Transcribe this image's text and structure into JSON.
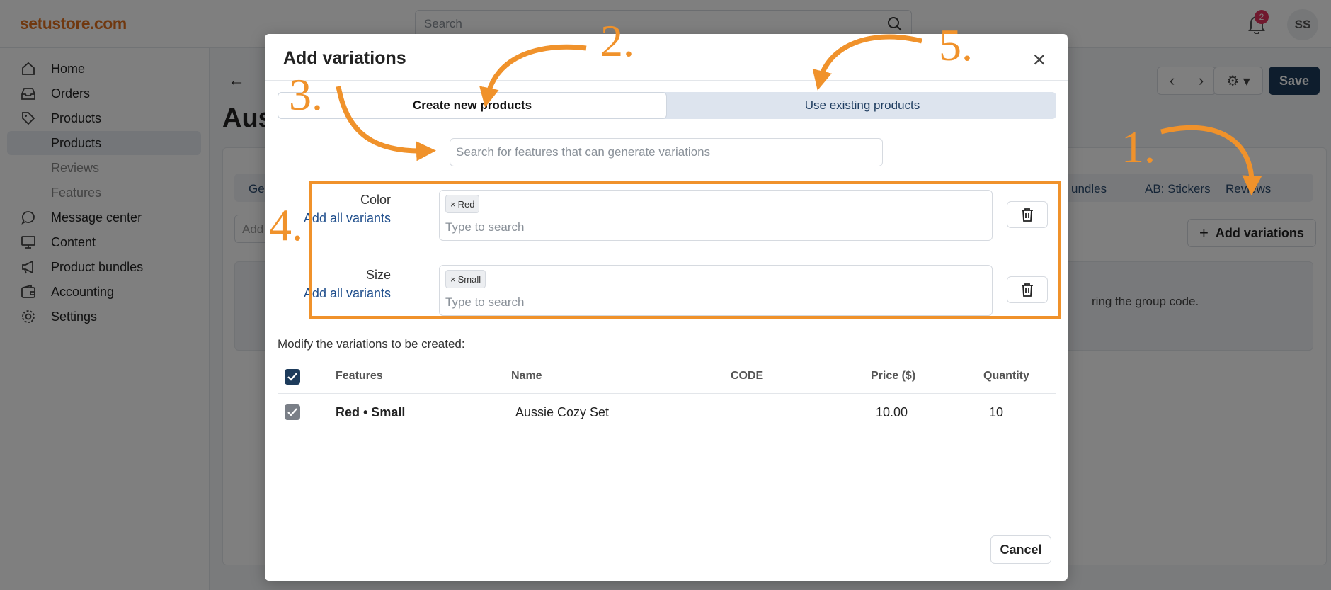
{
  "app": {
    "logo": "setustore.com",
    "search_placeholder": "Search",
    "notification_count": "2",
    "user_initials": "SS"
  },
  "sidebar": {
    "items": [
      {
        "label": "Home",
        "icon": "home-icon"
      },
      {
        "label": "Orders",
        "icon": "inbox-icon"
      },
      {
        "label": "Products",
        "icon": "tag-icon"
      },
      {
        "label": "Products",
        "icon": "",
        "sub": true,
        "active": true
      },
      {
        "label": "Reviews",
        "icon": "",
        "sub": true
      },
      {
        "label": "Features",
        "icon": "",
        "sub": true
      },
      {
        "label": "Message center",
        "icon": "chat-icon"
      },
      {
        "label": "Content",
        "icon": "monitor-icon"
      },
      {
        "label": "Product bundles",
        "icon": "megaphone-icon"
      },
      {
        "label": "Accounting",
        "icon": "wallet-icon"
      },
      {
        "label": "Settings",
        "icon": "gear-icon"
      }
    ]
  },
  "page": {
    "title": "Aus",
    "save_label": "Save",
    "tab_first": "Ge",
    "tab_bundles": "undles",
    "tab_stickers": "AB: Stickers",
    "tab_reviews": "Reviews",
    "add_input_placeholder": "Add",
    "add_variations_label": "Add variations",
    "info_text": "ring the group code."
  },
  "modal": {
    "title": "Add variations",
    "tab_create": "Create new products",
    "tab_existing": "Use existing products",
    "feature_search_placeholder": "Search for features that can generate variations",
    "features": [
      {
        "name": "Color",
        "add_all": "Add all variants",
        "tag": "Red",
        "input_placeholder": "Type to search"
      },
      {
        "name": "Size",
        "add_all": "Add all variants",
        "tag": "Small",
        "input_placeholder": "Type to search"
      }
    ],
    "modify_label": "Modify the variations to be created:",
    "table": {
      "headers": [
        "Features",
        "Name",
        "CODE",
        "Price ($)",
        "Quantity"
      ],
      "rows": [
        {
          "features": "Red • Small",
          "name": "Aussie Cozy Set",
          "code": "",
          "price": "10.00",
          "quantity": "10",
          "checked": true
        }
      ]
    },
    "cancel_label": "Cancel"
  },
  "annotations": {
    "steps": [
      "1.",
      "2.",
      "3.",
      "4.",
      "5."
    ],
    "color": "#f0922b"
  },
  "colors": {
    "brand": "#e0701f",
    "primary": "#1d3b5b",
    "link": "#1f4e8c",
    "annotation": "#f0922b"
  }
}
